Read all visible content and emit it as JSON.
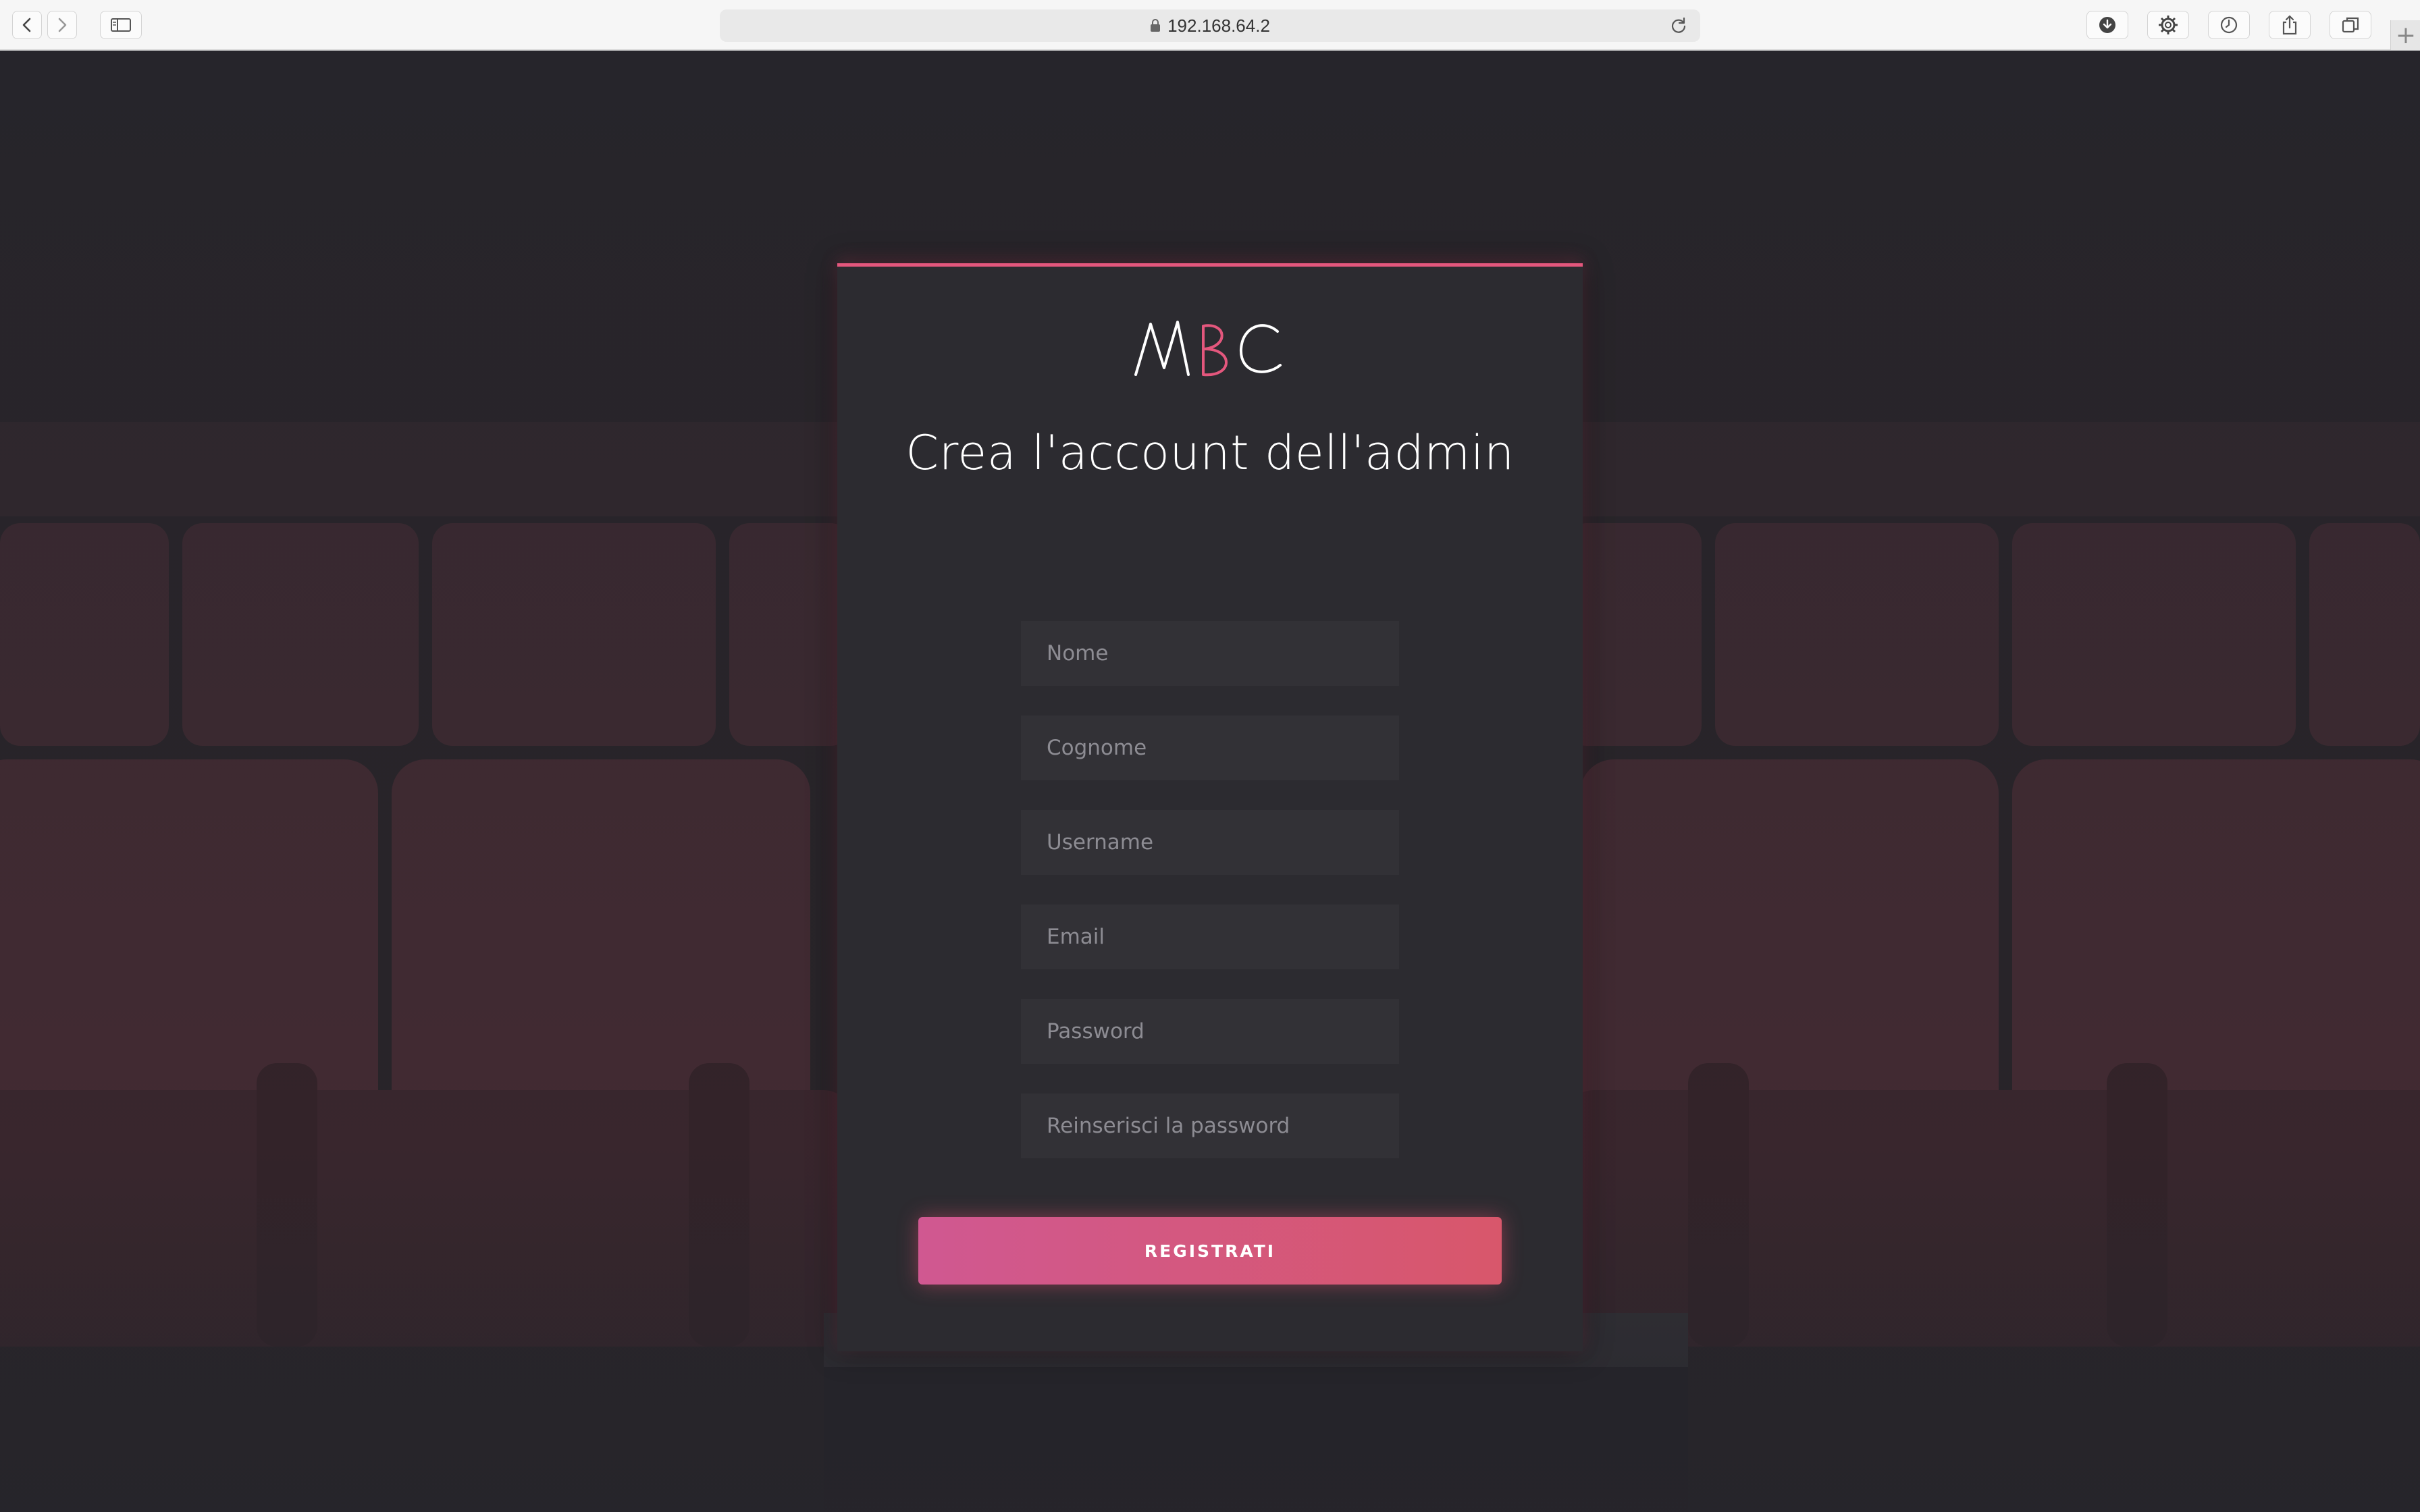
{
  "browser": {
    "url": "192.168.64.2",
    "new_tab_symbol": "+",
    "icons": [
      "back-icon",
      "forward-icon",
      "sidebar-icon",
      "lock-icon",
      "reload-icon",
      "download-icon",
      "gear-icon",
      "history-icon",
      "share-icon",
      "tabs-icon"
    ]
  },
  "card": {
    "logo": "MBC",
    "title": "Crea l'account dell'admin",
    "fields": {
      "nome": "Nome",
      "cognome": "Cognome",
      "username": "Username",
      "email": "Email",
      "password": "Password",
      "password_confirm": "Reinserisci la password"
    },
    "submit_label": "REGISTRATI"
  },
  "colors": {
    "accent": "#e4577d",
    "background": "#26252b",
    "card": "#2c2b30",
    "button_gradient_start": "#d05891",
    "button_gradient_end": "#d8576b"
  }
}
